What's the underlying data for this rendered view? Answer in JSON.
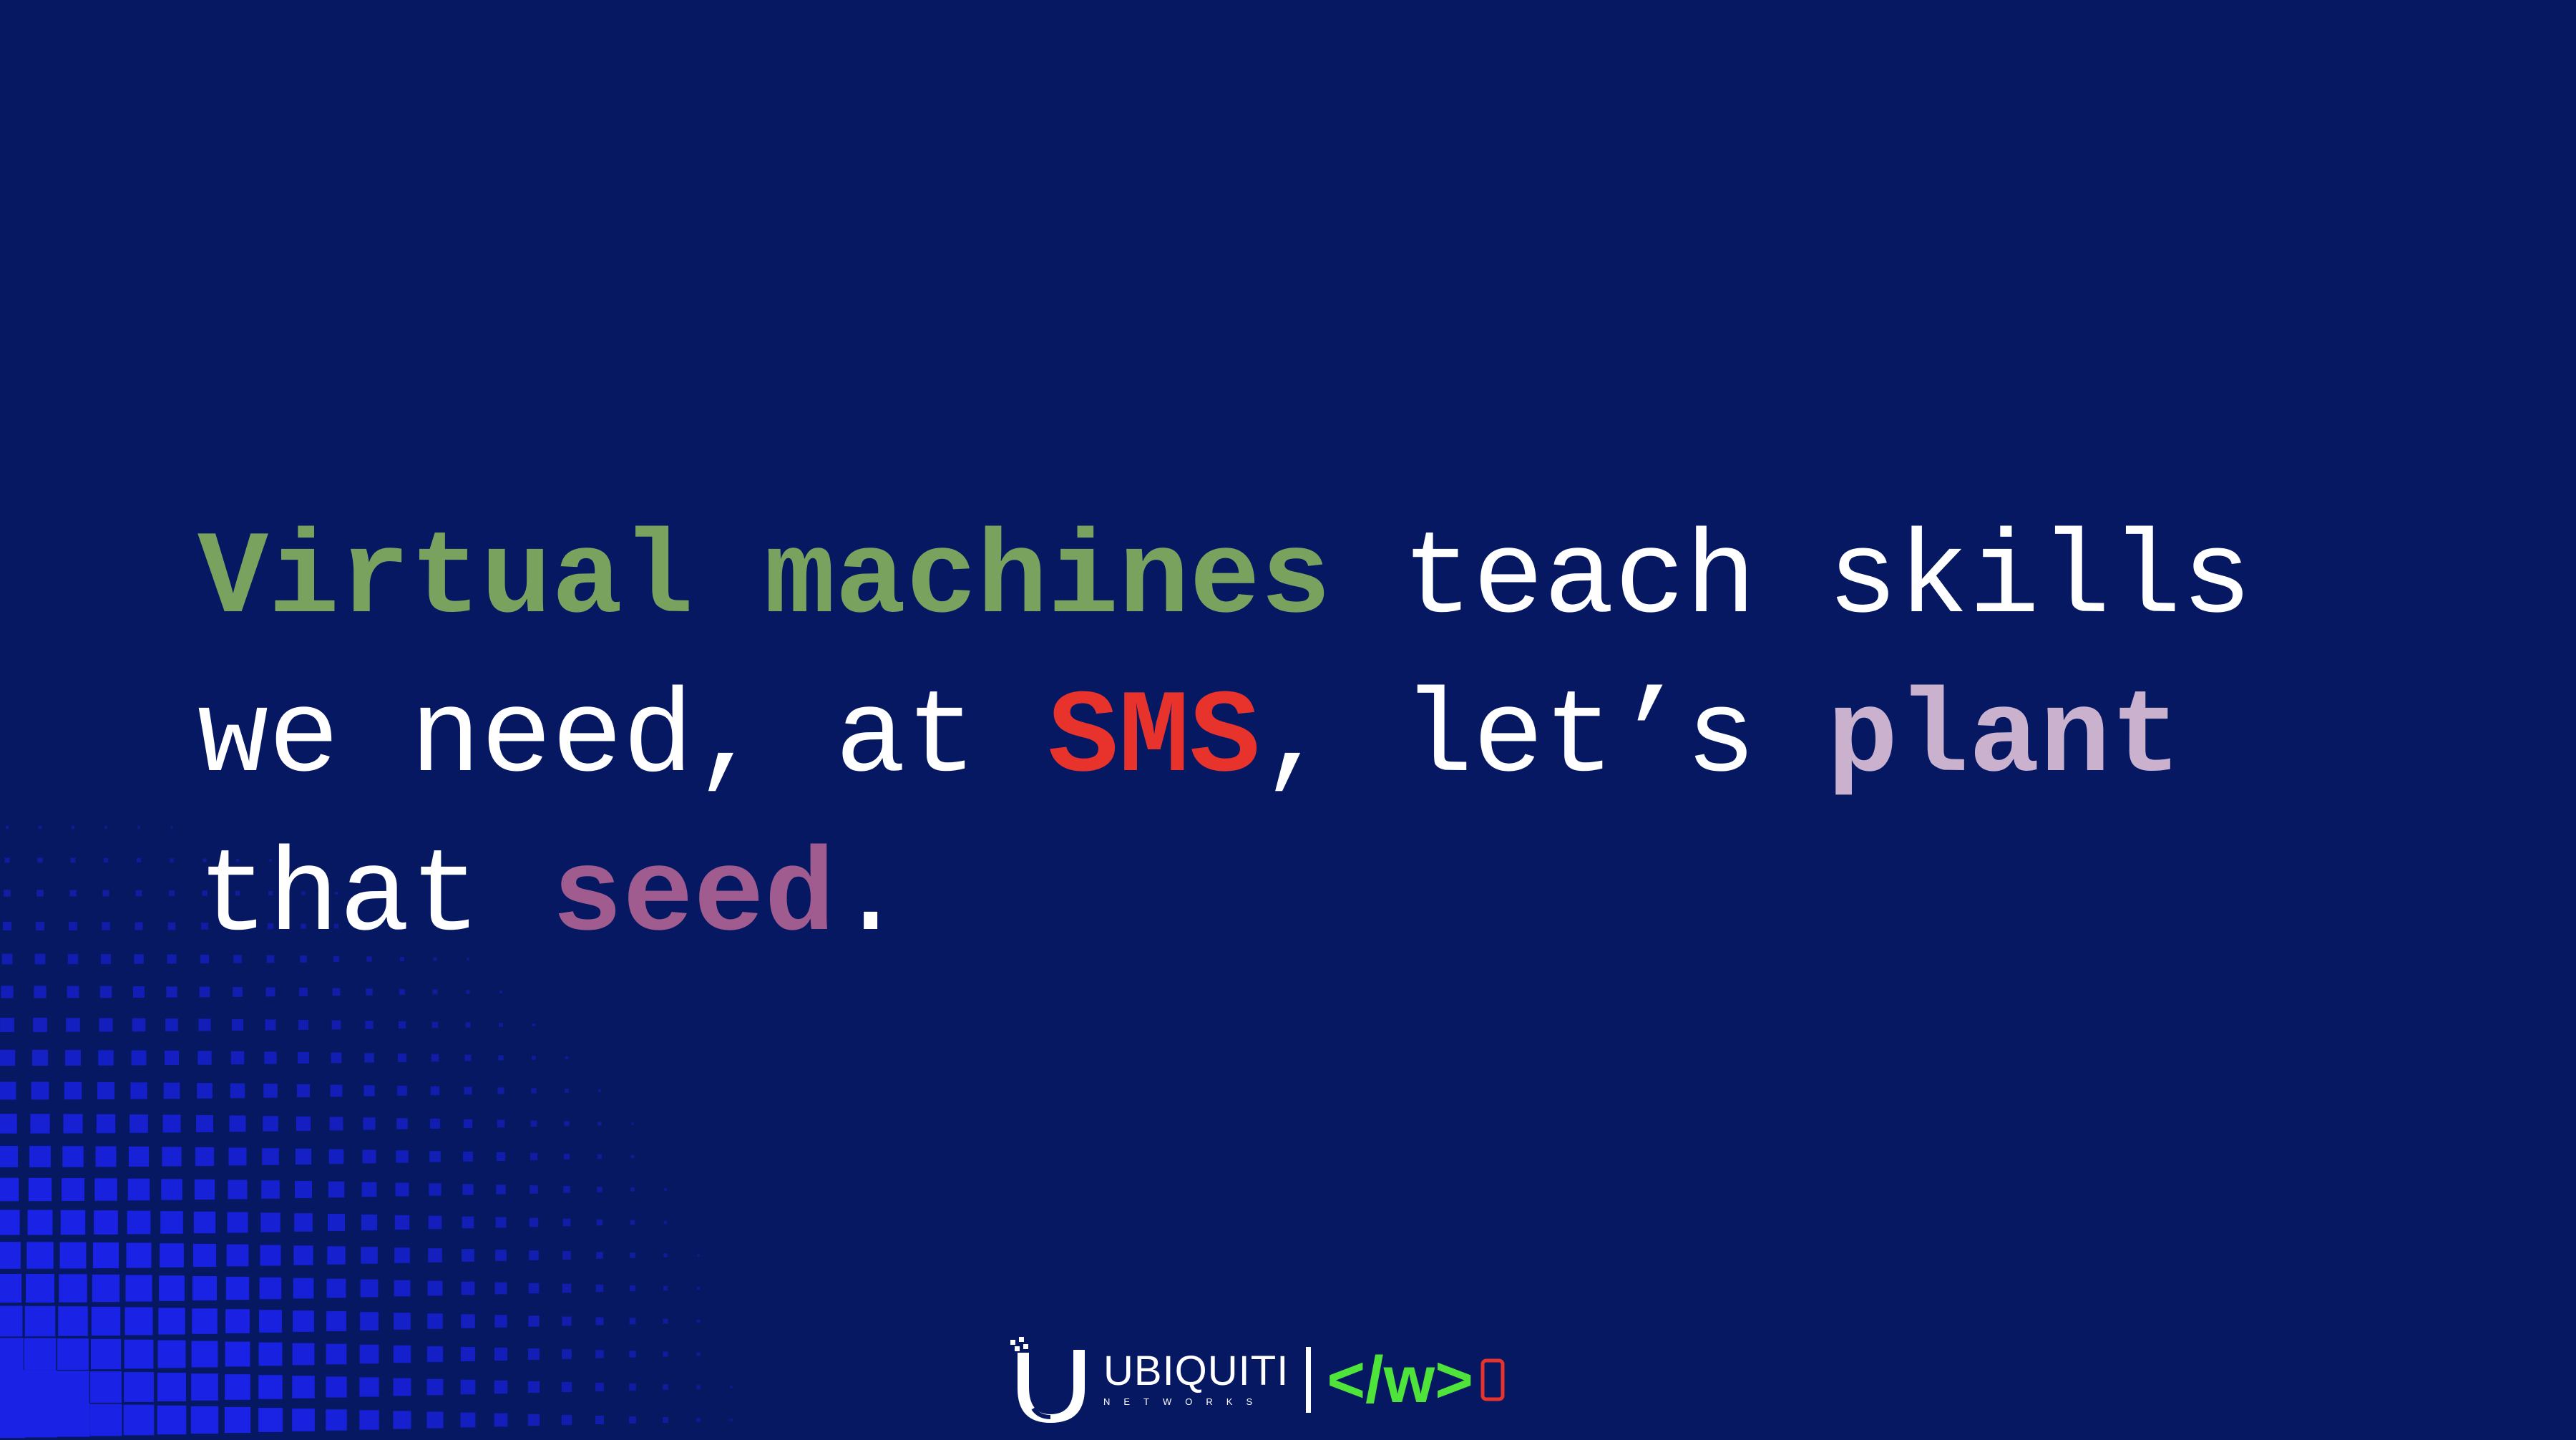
{
  "headline": {
    "line1": [
      {
        "text": "Virtual machines",
        "style": "bold",
        "color": "#7aa25f"
      },
      {
        "text": " teach skills",
        "style": "normal",
        "color": "#ffffff"
      }
    ],
    "line2": [
      {
        "text": "we need, at ",
        "style": "normal",
        "color": "#ffffff"
      },
      {
        "text": "SMS",
        "style": "bold",
        "color": "#e8322c"
      },
      {
        "text": ", let’s ",
        "style": "normal",
        "color": "#ffffff"
      },
      {
        "text": "plant",
        "style": "bold",
        "color": "#cab2cf"
      }
    ],
    "line3": [
      {
        "text": "that ",
        "style": "normal",
        "color": "#ffffff"
      },
      {
        "text": "seed",
        "style": "bold",
        "color": "#a05c8e"
      },
      {
        "text": ".",
        "style": "normal",
        "color": "#ffffff"
      }
    ]
  },
  "footer": {
    "ubiquiti_name": "UBIQUITI",
    "ubiquiti_sub": "NETWORKS",
    "code_logo": "</w>"
  },
  "icons": {
    "ubiquiti_logo": "ubiquiti-u-logo-icon",
    "phone": "phone-outline-icon"
  },
  "colors": {
    "background": "#071863",
    "dot_pattern": "#1a22e6",
    "code_logo": "#4ee43a",
    "phone_icon": "#e8322c"
  }
}
